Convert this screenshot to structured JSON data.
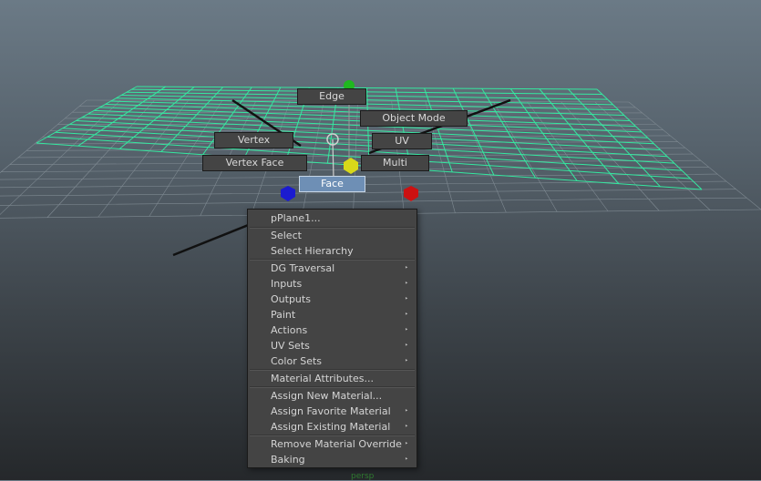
{
  "marking_menu": {
    "edge": "Edge",
    "object_mode": "Object Mode",
    "vertex": "Vertex",
    "uv": "UV",
    "vertex_face": "Vertex Face",
    "multi": "Multi",
    "face": "Face"
  },
  "context_menu": {
    "header": "pPlane1...",
    "items": [
      {
        "label": "Select",
        "submenu": false
      },
      {
        "label": "Select Hierarchy",
        "submenu": false
      },
      {
        "label": "DG Traversal",
        "submenu": true
      },
      {
        "label": "Inputs",
        "submenu": true
      },
      {
        "label": "Outputs",
        "submenu": true
      },
      {
        "label": "Paint",
        "submenu": true
      },
      {
        "label": "Actions",
        "submenu": true
      },
      {
        "label": "UV Sets",
        "submenu": true
      },
      {
        "label": "Color Sets",
        "submenu": true
      },
      {
        "label": "Material Attributes...",
        "submenu": false
      },
      {
        "label": "Assign New Material...",
        "submenu": false
      },
      {
        "label": "Assign Favorite Material",
        "submenu": true
      },
      {
        "label": "Assign Existing Material",
        "submenu": true
      },
      {
        "label": "Remove Material Override",
        "submenu": true
      },
      {
        "label": "Baking",
        "submenu": true
      }
    ],
    "submenu_glyph": "‣"
  },
  "colors": {
    "grid_line": "#7f8a92",
    "plane_wire": "#35e8a0",
    "axis_line": "#111111",
    "menu_bg": "#444444",
    "active_button": "#6e8fb5",
    "manip_blue": "#1b1bd0",
    "manip_red": "#cc1111",
    "manip_green": "#1fb81f",
    "manip_yellow": "#d8d81a"
  },
  "footer_hint": "persp"
}
